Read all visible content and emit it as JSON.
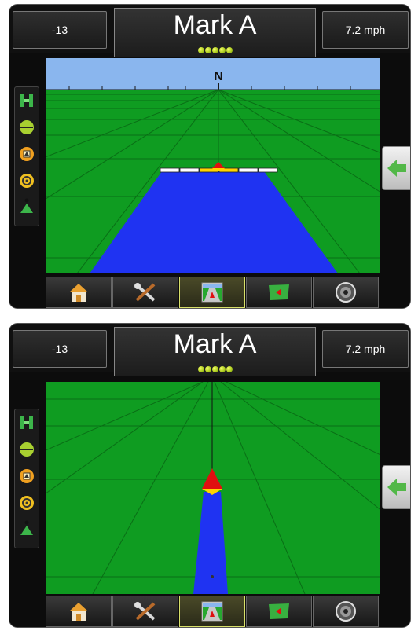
{
  "screens": [
    {
      "id": "perspective-view",
      "header": {
        "left_value": "-13",
        "title": "Mark A",
        "right_value": "7.2 mph",
        "led_count": 5
      },
      "compass": {
        "heading": "N"
      },
      "side_rail": [
        "guidance-mode-icon",
        "boundary-icon",
        "marker-icon",
        "steering-icon",
        "vehicle-icon"
      ],
      "back_button": "back-arrow-icon",
      "nav": [
        {
          "name": "home-tab",
          "icon": "home-icon",
          "active": false
        },
        {
          "name": "tools-tab",
          "icon": "tools-icon",
          "active": false
        },
        {
          "name": "guidance-tab",
          "icon": "guidance-icon",
          "active": true
        },
        {
          "name": "field-tab",
          "icon": "field-icon",
          "active": false
        },
        {
          "name": "gps-tab",
          "icon": "gps-icon",
          "active": false
        }
      ]
    },
    {
      "id": "overhead-view",
      "header": {
        "left_value": "-13",
        "title": "Mark A",
        "right_value": "7.2 mph",
        "led_count": 5
      },
      "side_rail": [
        "guidance-mode-icon",
        "boundary-icon",
        "marker-icon",
        "steering-icon",
        "vehicle-icon"
      ],
      "back_button": "back-arrow-icon",
      "nav": [
        {
          "name": "home-tab",
          "icon": "home-icon",
          "active": false
        },
        {
          "name": "tools-tab",
          "icon": "tools-icon",
          "active": false
        },
        {
          "name": "guidance-tab",
          "icon": "guidance-icon",
          "active": true
        },
        {
          "name": "field-tab",
          "icon": "field-icon",
          "active": false
        },
        {
          "name": "gps-tab",
          "icon": "gps-icon",
          "active": false
        }
      ]
    }
  ],
  "colors": {
    "field_green": "#0f9c21",
    "grid_line": "#0a6e16",
    "coverage_blue": "#1f33f2",
    "sky_blue": "#8ab6ee",
    "marker_red": "#e01010",
    "marker_yellow": "#ffd400",
    "led_green": "#c8e22a"
  }
}
